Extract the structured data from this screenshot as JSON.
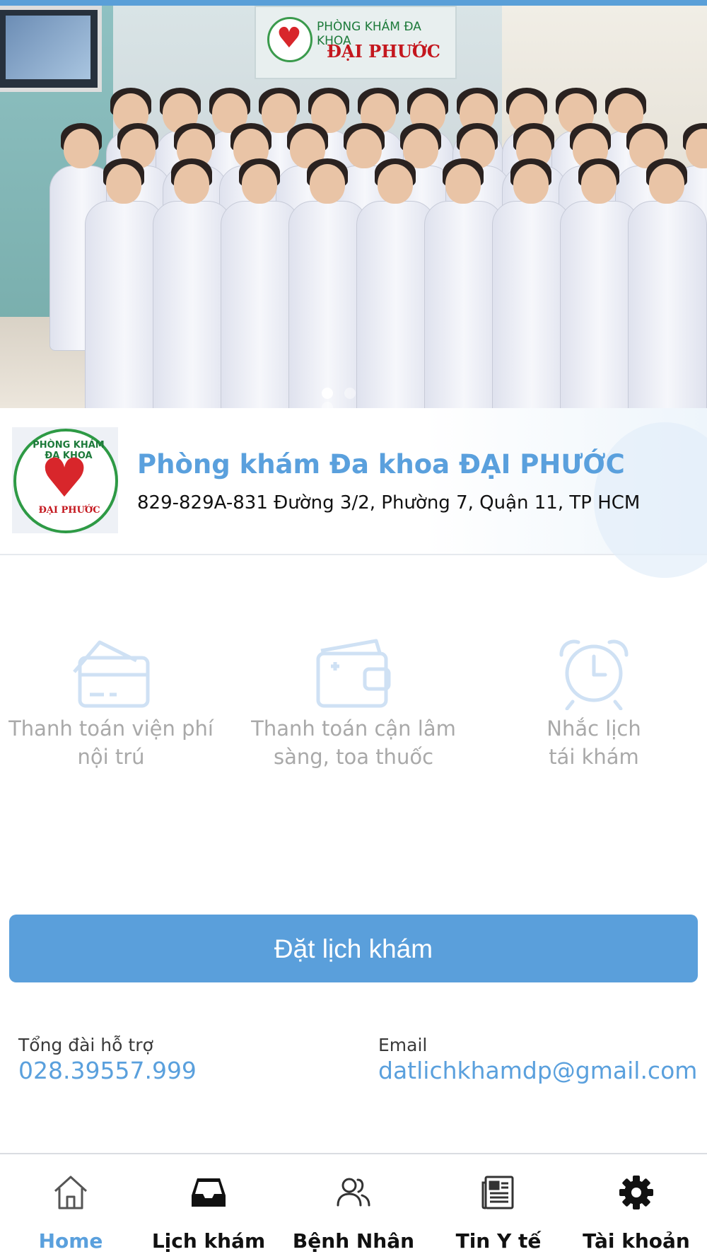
{
  "hero": {
    "sign_line1": "PHÒNG KHÁM ĐA KHOA",
    "sign_line2": "ĐẠI PHƯỚC",
    "slides": 3,
    "active_slide": 1
  },
  "clinic": {
    "logo_top": "PHÒNG KHÁM ĐA KHOA",
    "logo_bottom": "ĐẠI PHƯỚC",
    "name": "Phòng khám Đa khoa ĐẠI PHƯỚC",
    "address": "829-829A-831 Đường 3/2, Phường 7, Quận 11, TP HCM"
  },
  "features": [
    {
      "icon": "credit-card-icon",
      "line1": "Thanh toán viện phí",
      "line2": "nội trú"
    },
    {
      "icon": "wallet-icon",
      "line1": "Thanh toán cận lâm",
      "line2": "sàng, toa thuốc"
    },
    {
      "icon": "alarm-clock-icon",
      "line1": "Nhắc lịch",
      "line2": "tái khám"
    }
  ],
  "book_button": "Đặt lịch khám",
  "contact": {
    "hotline_label": "Tổng đài hỗ trợ",
    "hotline": "028.39557.999",
    "email_label": "Email",
    "email": "datlichkhamdp@gmail.com"
  },
  "tabs": [
    {
      "icon": "home-icon",
      "label": "Home",
      "active": true
    },
    {
      "icon": "inbox-icon",
      "label": "Lịch khám",
      "active": false
    },
    {
      "icon": "users-icon",
      "label": "Bệnh Nhân",
      "active": false
    },
    {
      "icon": "newspaper-icon",
      "label": "Tin Y tế",
      "active": false
    },
    {
      "icon": "gear-icon",
      "label": "Tài khoản",
      "active": false
    }
  ],
  "colors": {
    "accent": "#5a9fdb",
    "feature_icon": "#cfe1f4",
    "feature_text": "#a9a9a9"
  }
}
